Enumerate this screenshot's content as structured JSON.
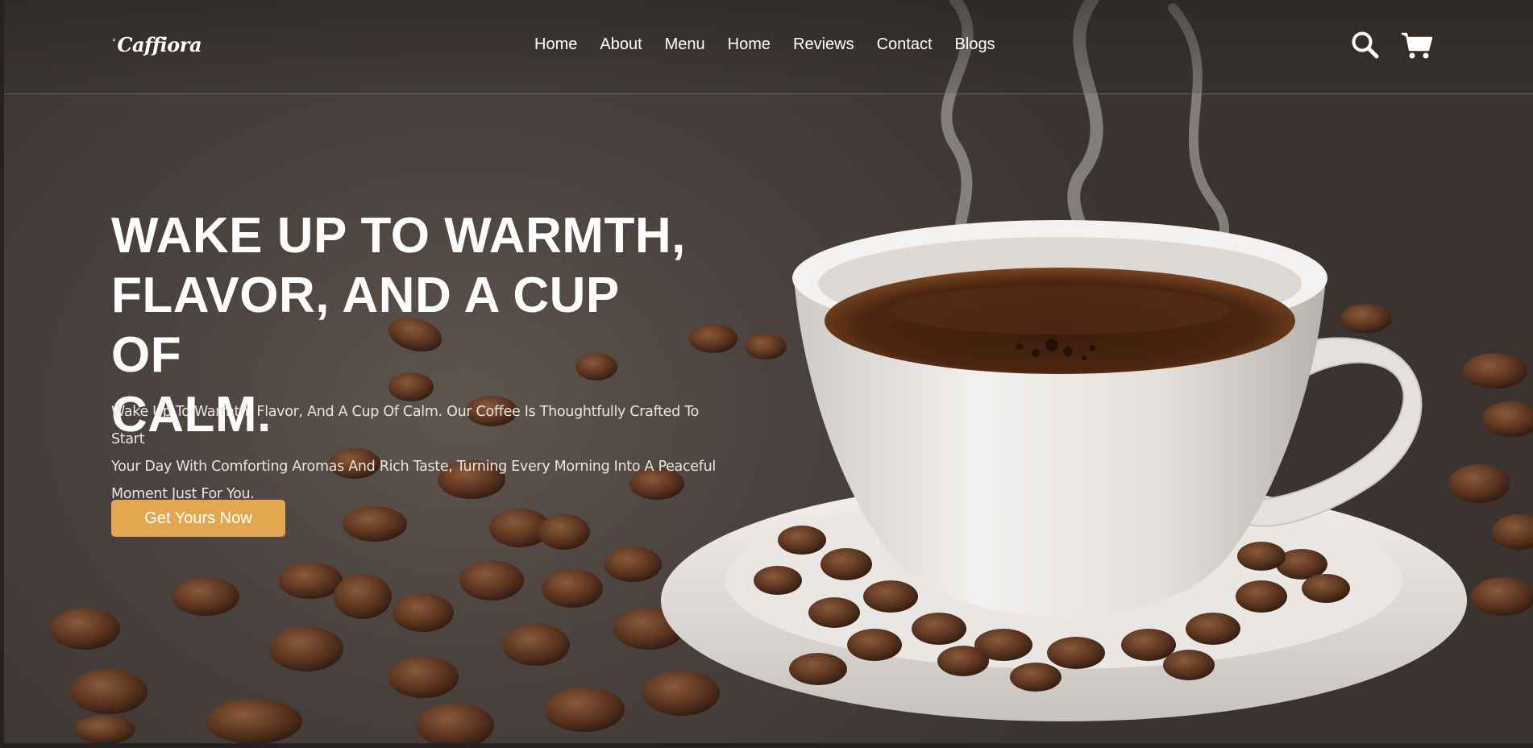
{
  "brand": {
    "name": "Caffiora",
    "logo_icon": "coffee-cup-logo"
  },
  "nav": {
    "items": [
      {
        "label": "Home"
      },
      {
        "label": "About"
      },
      {
        "label": "Menu"
      },
      {
        "label": "Home"
      },
      {
        "label": "Reviews"
      },
      {
        "label": "Contact"
      },
      {
        "label": "Blogs"
      }
    ]
  },
  "header_icons": {
    "search": "search-icon",
    "cart": "cart-icon"
  },
  "hero": {
    "headline_line1": "WAKE UP TO WARMTH,",
    "headline_line2": "FLAVOR, AND A CUP OF",
    "headline_line3": "CALM.",
    "description_line1": "Wake Up To Warmth, Flavor, And A Cup Of Calm. Our Coffee Is Thoughtfully Crafted To Start",
    "description_line2": "Your Day With Comforting Aromas And Rich Taste, Turning Every Morning Into A Peaceful",
    "description_line3": "Moment Just For You.",
    "cta_label": "Get Yours Now"
  },
  "colors": {
    "accent": "#e3a84f",
    "background": "#4a423e",
    "text": "#ffffff"
  }
}
